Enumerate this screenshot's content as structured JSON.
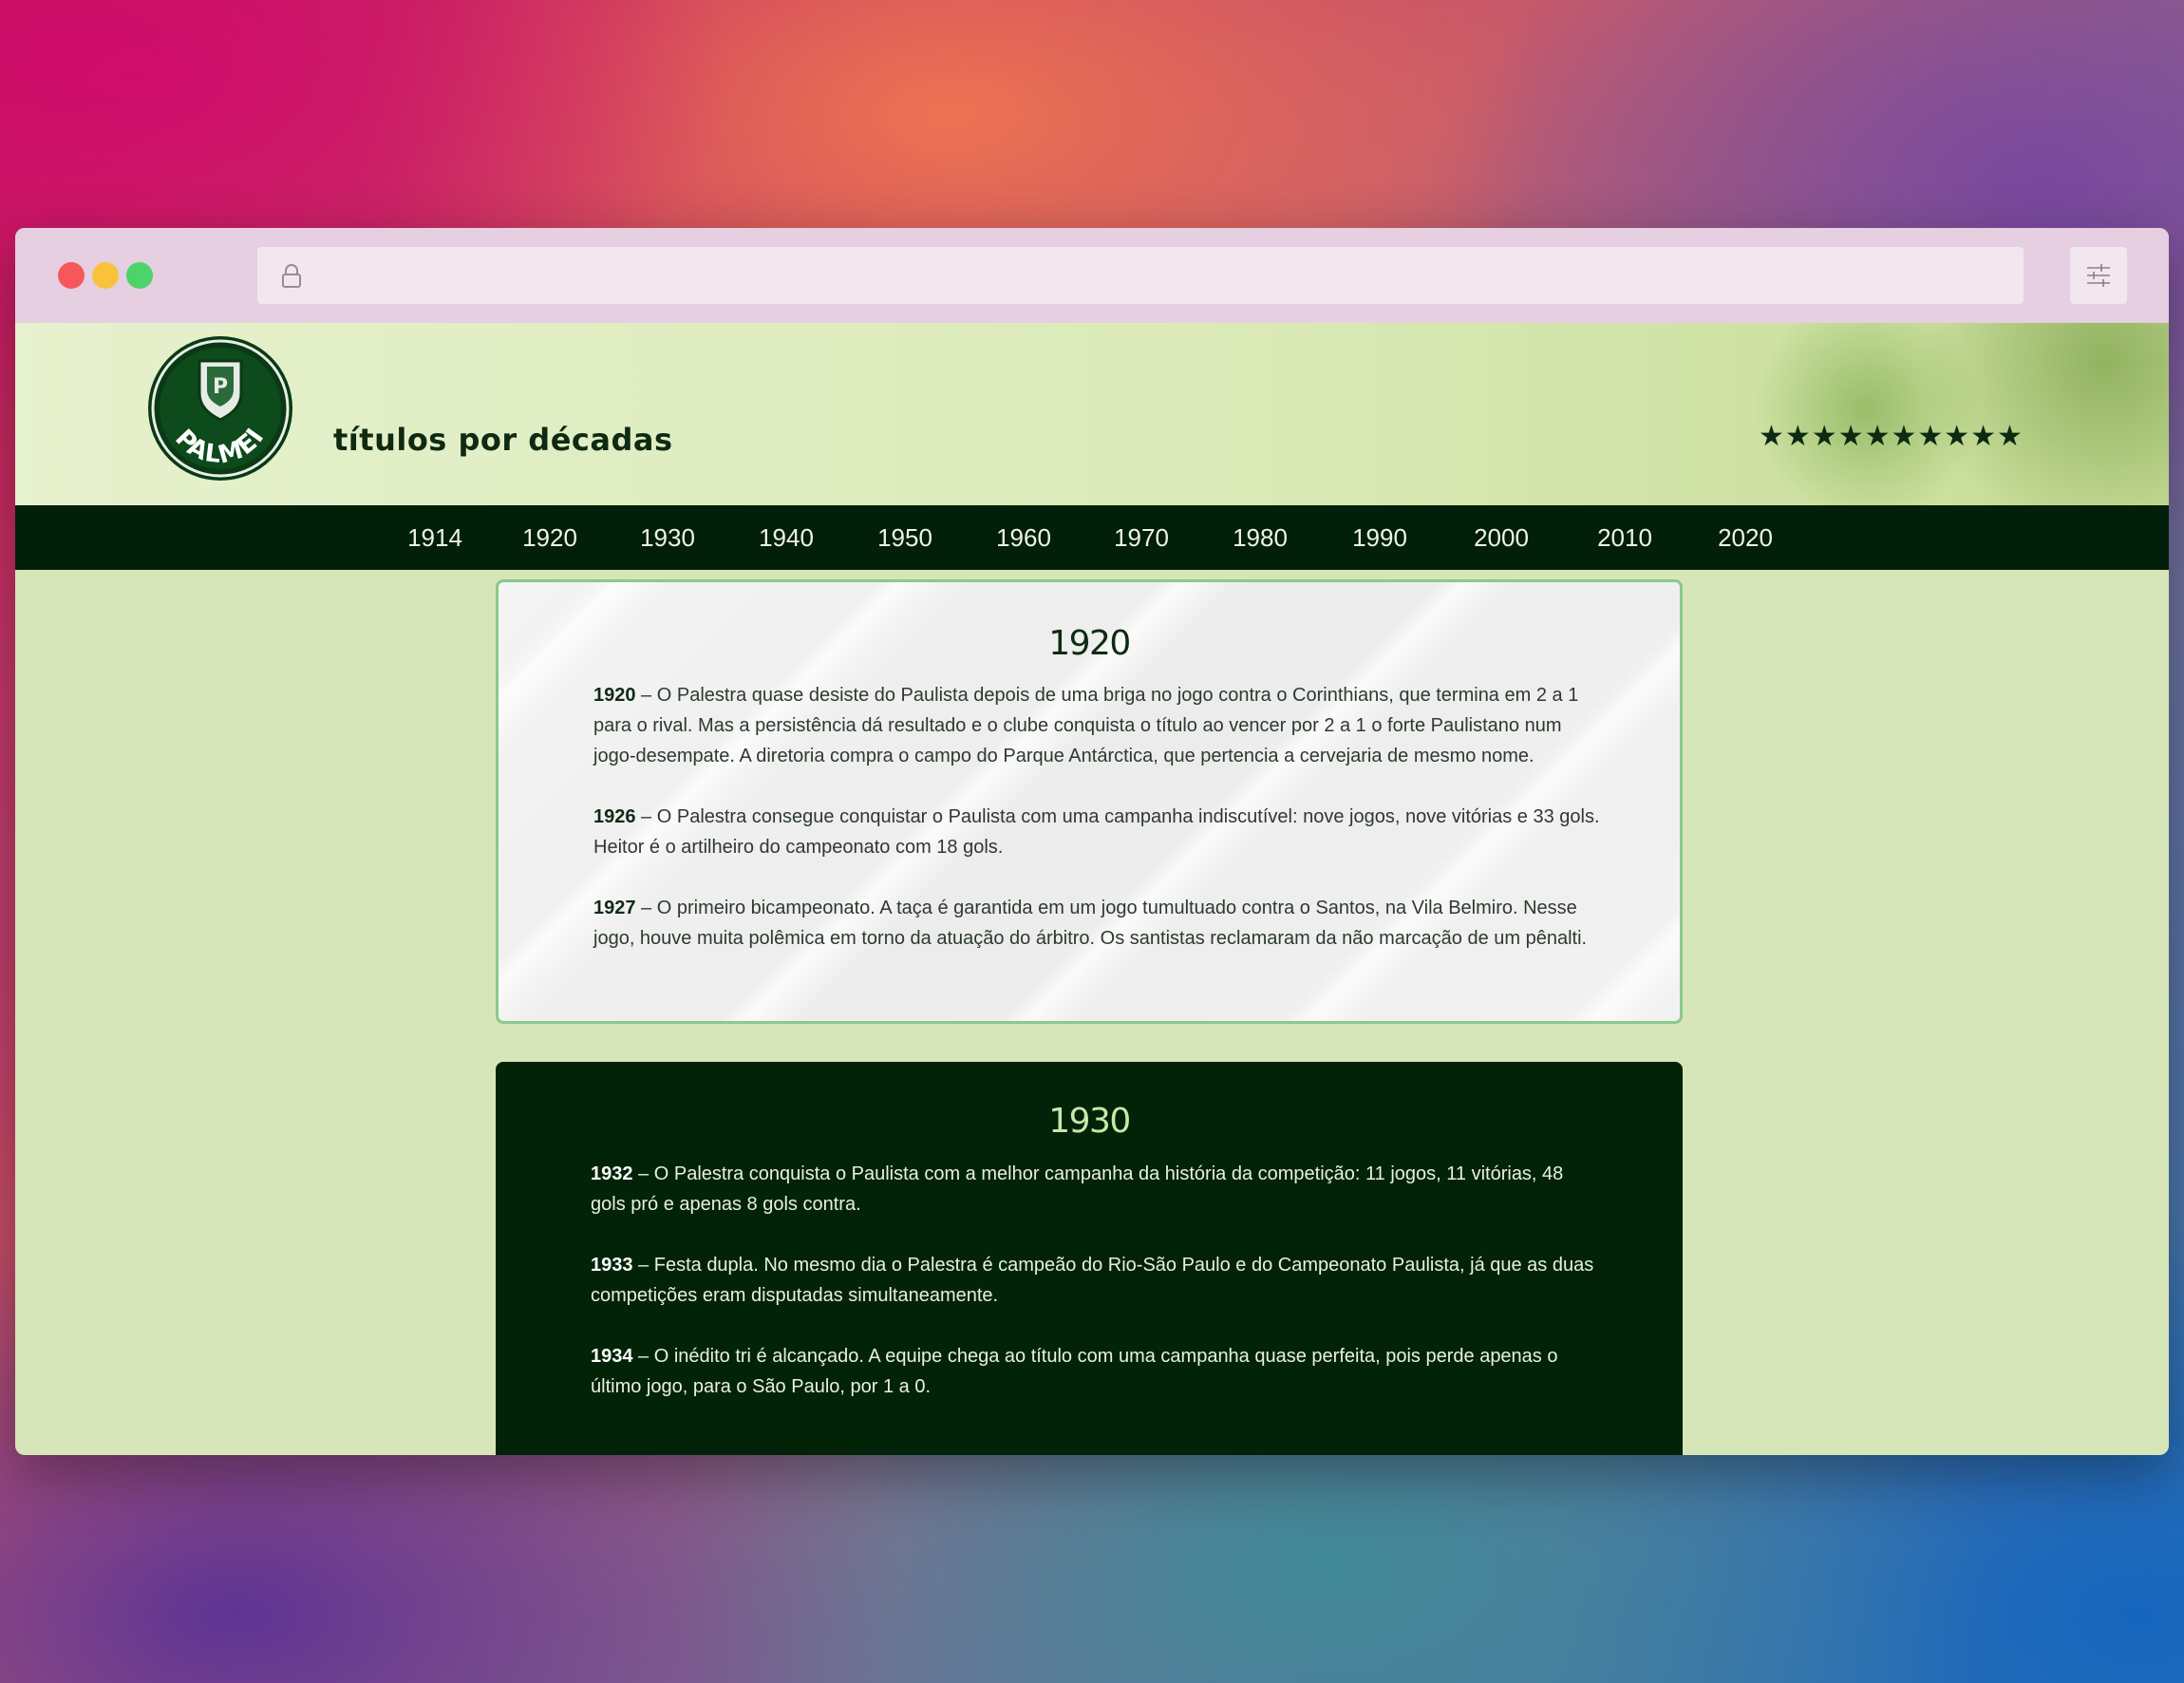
{
  "browser": {
    "url": ""
  },
  "header": {
    "logo_text": "PALMEIRAS",
    "title": "títulos por décadas",
    "stars": "★★★★★★★★★★"
  },
  "nav": {
    "items": [
      "1914",
      "1920",
      "1930",
      "1940",
      "1950",
      "1960",
      "1970",
      "1980",
      "1990",
      "2000",
      "2010",
      "2020"
    ]
  },
  "sections": [
    {
      "title": "1920",
      "entries": [
        {
          "year": "1920",
          "text": " – O Palestra quase desiste do Paulista depois de uma briga no jogo contra o Corinthians, que termina em 2 a 1 para o rival. Mas a persistência dá resultado e o clube conquista o título ao vencer por 2 a 1 o forte Paulistano num jogo-desempate. A diretoria compra o campo do Parque Antárctica, que pertencia a cervejaria de mesmo nome."
        },
        {
          "year": "1926",
          "text": " – O Palestra consegue conquistar o Paulista com uma campanha indiscutível: nove jogos, nove vitórias e 33 gols. Heitor é o artilheiro do campeonato com 18 gols."
        },
        {
          "year": "1927",
          "text": " – O primeiro bicampeonato. A taça é garantida em um jogo tumultuado contra o Santos, na Vila Belmiro. Nesse jogo, houve muita polêmica em torno da atuação do árbitro. Os santistas reclamaram da não marcação de um pênalti."
        }
      ]
    },
    {
      "title": "1930",
      "entries": [
        {
          "year": "1932",
          "text": " – O Palestra conquista o Paulista com a melhor campanha da história da competição: 11 jogos, 11 vitórias, 48 gols pró e apenas 8 gols contra."
        },
        {
          "year": "1933",
          "text": " – Festa dupla. No mesmo dia o Palestra é campeão do Rio-São Paulo e do Campeonato Paulista, já que as duas competições eram disputadas simultaneamente."
        },
        {
          "year": "1934",
          "text": " – O inédito tri é alcançado. A equipe chega ao título com uma campanha quase perfeita, pois perde apenas o último jogo, para o São Paulo, por 1 a 0."
        }
      ]
    }
  ],
  "colors": {
    "nav_bg": "#021f09",
    "dark_card_bg": "#022308",
    "page_bg": "#d7e6b8",
    "accent_border": "#8bc98a"
  }
}
